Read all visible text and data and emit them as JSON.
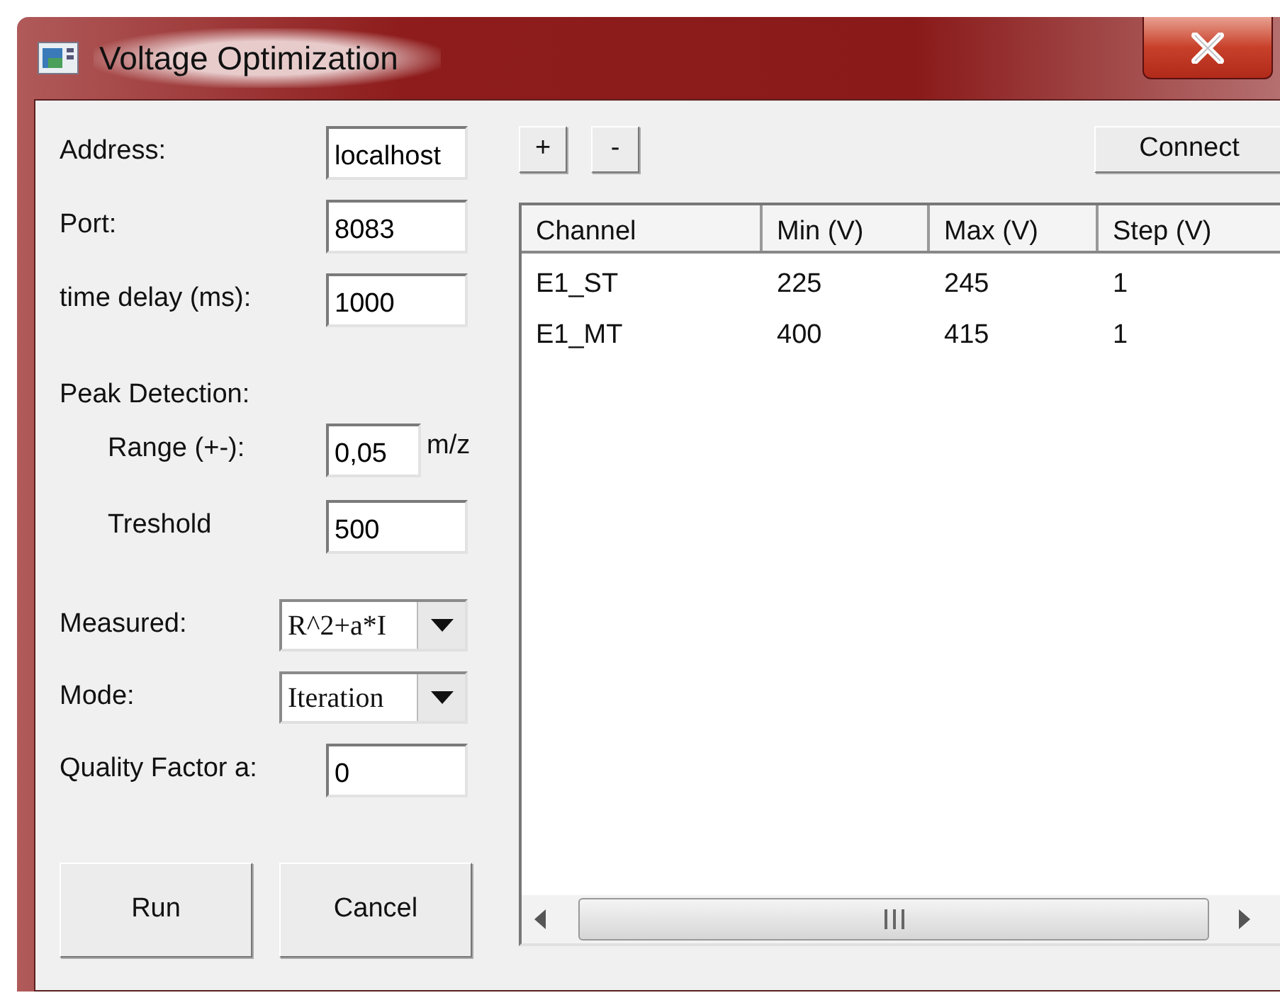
{
  "window": {
    "title": "Voltage Optimization"
  },
  "settings": [
    {
      "label": "Address:",
      "value": "localhost"
    },
    {
      "label": "Port:",
      "value": "8083"
    },
    {
      "label": "time delay (ms):",
      "value": "1000"
    }
  ],
  "peak_detection": {
    "label": "Peak Detection:",
    "fields": [
      {
        "label": "Range (+-):",
        "value": "0,05",
        "unit": "m/z"
      },
      {
        "label": "Treshold",
        "value": "500"
      }
    ]
  },
  "options": [
    {
      "kind": "select",
      "label": "Measured:",
      "value": "R^2+a*I"
    },
    {
      "kind": "select",
      "label": "Mode:",
      "value": "Iteration"
    },
    {
      "kind": "text",
      "label": "Quality Factor a:",
      "value": "0"
    }
  ],
  "buttons": [
    "Run",
    "Cancel"
  ],
  "toolbar": {
    "buttons": [
      "+",
      "-"
    ],
    "connect": "Connect"
  },
  "table": {
    "columns": [
      "Channel",
      "Min (V)",
      "Max (V)",
      "Step (V)"
    ],
    "rows": [
      [
        "E1_ST",
        "225",
        "245",
        "1"
      ],
      [
        "E1_MT",
        "400",
        "415",
        "1"
      ]
    ]
  }
}
